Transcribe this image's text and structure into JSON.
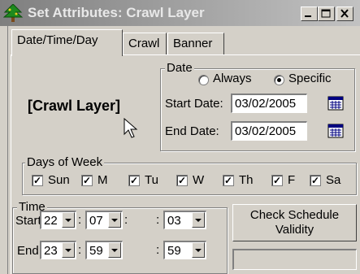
{
  "window": {
    "title": "Set Attributes: Crawl Layer"
  },
  "tabs": [
    {
      "label": "Date/Time/Day"
    },
    {
      "label": "Crawl"
    },
    {
      "label": "Banner"
    }
  ],
  "layer_label": "[Crawl Layer]",
  "date": {
    "group_label": "Date",
    "always_label": "Always",
    "specific_label": "Specific",
    "selected": "Specific",
    "start_label": "Start Date:",
    "start_value": "03/02/2005",
    "end_label": "End Date:",
    "end_value": "03/02/2005"
  },
  "days": {
    "group_label": "Days of Week",
    "items": [
      {
        "label": "Sun",
        "checked": true
      },
      {
        "label": "M",
        "checked": true
      },
      {
        "label": "Tu",
        "checked": true
      },
      {
        "label": "W",
        "checked": true
      },
      {
        "label": "Th",
        "checked": true
      },
      {
        "label": "F",
        "checked": true
      },
      {
        "label": "Sa",
        "checked": true
      }
    ]
  },
  "time": {
    "group_label": "Time",
    "start_label": "Start:",
    "end_label": "End:",
    "separator": ":",
    "start": [
      "22",
      "07",
      "03"
    ],
    "end": [
      "23",
      "59",
      "59"
    ]
  },
  "check_button": {
    "label_line1": "Check Schedule",
    "label_line2": "Validity"
  },
  "status_text": ""
}
